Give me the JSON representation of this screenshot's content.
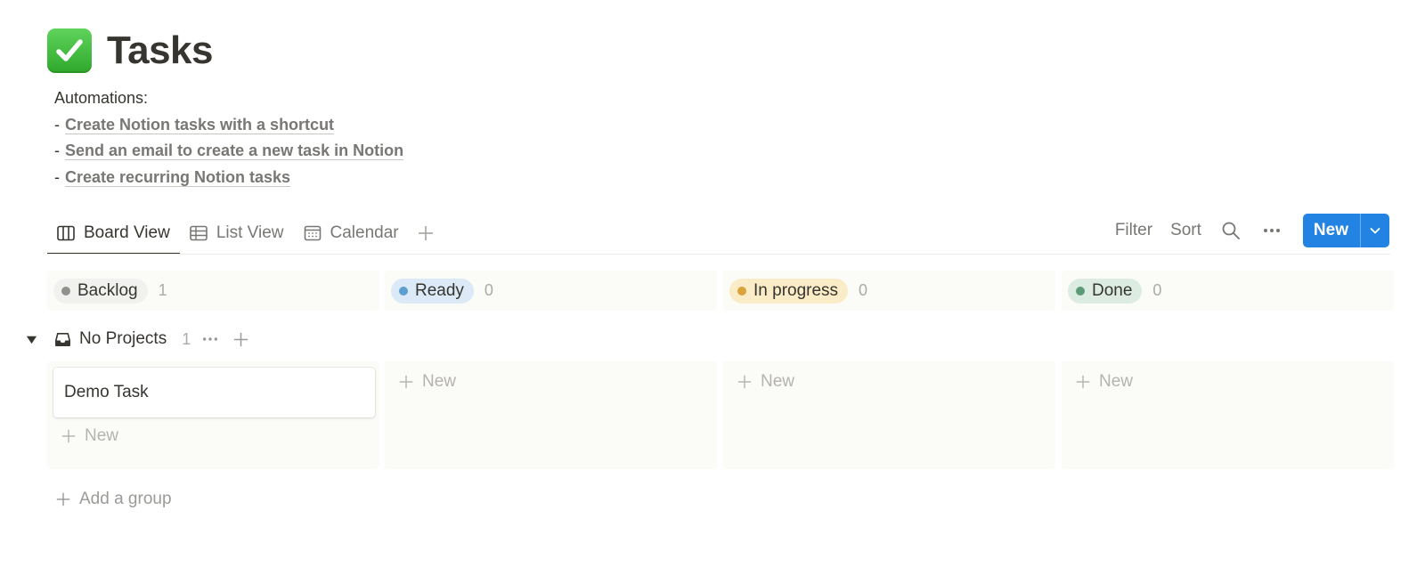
{
  "page": {
    "title": "Tasks",
    "icon": "check-mark-button-icon"
  },
  "description": {
    "heading": "Automations:",
    "bullet": "-",
    "links": [
      "Create Notion tasks with a shortcut",
      "Send an email to create a new task in Notion",
      "Create recurring Notion tasks"
    ]
  },
  "views": {
    "tabs": [
      {
        "label": "Board View",
        "icon": "board-icon",
        "active": true
      },
      {
        "label": "List View",
        "icon": "table-icon",
        "active": false
      },
      {
        "label": "Calendar",
        "icon": "calendar-icon",
        "active": false
      }
    ],
    "add_icon": "plus-icon"
  },
  "toolbar": {
    "filter_label": "Filter",
    "sort_label": "Sort",
    "search_icon": "search-icon",
    "more_icon": "more-horizontal-icon",
    "new_label": "New",
    "new_dropdown_icon": "chevron-down-icon",
    "accent_color": "#2383e2"
  },
  "columns": [
    {
      "label": "Backlog",
      "count": "1",
      "dot_color": "#91918e",
      "pill_bg": "#f1f1ef"
    },
    {
      "label": "Ready",
      "count": "0",
      "dot_color": "#5e9fd0",
      "pill_bg": "#dbeaf6"
    },
    {
      "label": "In progress",
      "count": "0",
      "dot_color": "#d9a23a",
      "pill_bg": "#fbecc8"
    },
    {
      "label": "Done",
      "count": "0",
      "dot_color": "#5b9b74",
      "pill_bg": "#dcece2"
    }
  ],
  "group": {
    "name": "No Projects",
    "count": "1",
    "icon": "inbox-icon",
    "toggle_icon": "triangle-down-icon",
    "more_icon": "more-horizontal-icon",
    "add_icon": "plus-icon"
  },
  "cards": [
    {
      "title": "Demo Task"
    }
  ],
  "new_item_label": "New",
  "add_group_label": "Add a group"
}
